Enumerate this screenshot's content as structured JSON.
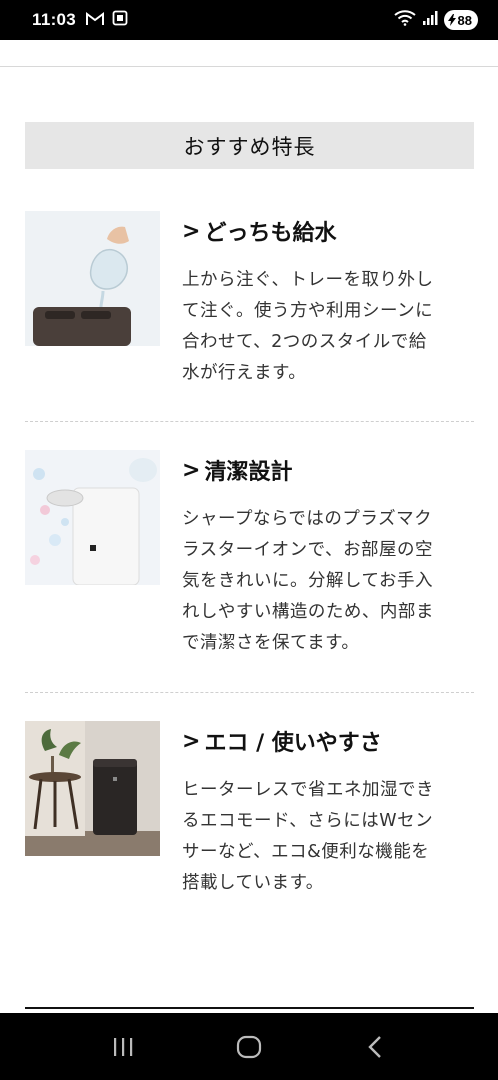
{
  "status_bar": {
    "time": "11:03",
    "battery": "88",
    "icons": [
      "gmail-icon",
      "screenshot-icon",
      "wifi-icon",
      "signal-icon",
      "battery-icon"
    ]
  },
  "section": {
    "title": "おすすめ特長"
  },
  "features": [
    {
      "title": "どっちも給水",
      "desc_lines": [
        "上から注ぐ、トレーを取り外し",
        "て注ぐ。使う方や利用シーンに",
        "合わせて、2つのスタイルで給",
        "水が行えます。"
      ]
    },
    {
      "title": "清潔設計",
      "desc_lines": [
        "シャープならではのプラズマク",
        "ラスターイオンで、お部屋の空",
        "気をきれいに。分解してお手入",
        "れしやすい構造のため、内部ま",
        "で清潔さを保てます。"
      ]
    },
    {
      "title": "エコ / 使いやすさ",
      "desc_lines": [
        "ヒーターレスで省エネ加湿でき",
        "るエコモード、さらにはWセン",
        "サーなど、エコ&便利な機能を",
        "搭載しています。"
      ]
    }
  ],
  "nav_bar": {
    "buttons": [
      "recents-icon",
      "home-icon",
      "back-icon"
    ]
  }
}
